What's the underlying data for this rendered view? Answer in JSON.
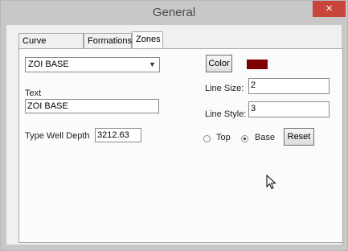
{
  "window": {
    "title": "General",
    "close_symbol": "×"
  },
  "tabs": [
    {
      "label": "Curve Settings",
      "active": false
    },
    {
      "label": "Formations",
      "active": false
    },
    {
      "label": "Zones",
      "active": true
    }
  ],
  "zones": {
    "zone_select_value": "ZOI BASE",
    "text_label": "Text",
    "text_value": "ZOI BASE",
    "type_well_depth_label": "Type Well Depth",
    "type_well_depth_value": "3212.63",
    "color_button_label": "Color",
    "color_value": "#7f0000",
    "line_size_label": "Line Size:",
    "line_size_value": "2",
    "line_style_label": "Line Style:",
    "line_style_value": "3",
    "position_options": [
      {
        "label": "Top",
        "selected": false
      },
      {
        "label": "Base",
        "selected": true
      }
    ],
    "reset_button_label": "Reset"
  }
}
